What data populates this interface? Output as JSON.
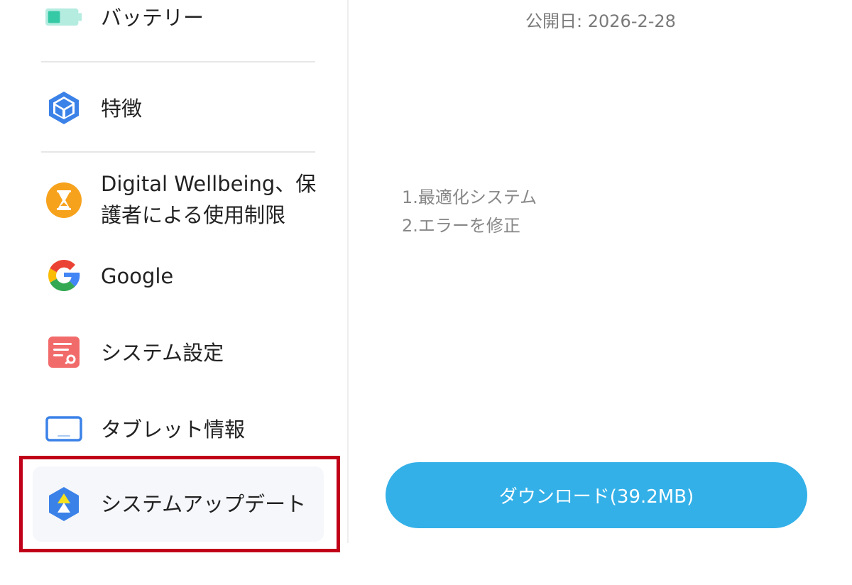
{
  "sidebar": {
    "items": [
      {
        "label": "バッテリー",
        "icon": "battery-icon"
      },
      {
        "label": "特徴",
        "icon": "cube-icon"
      },
      {
        "label_line1": "Digital Wellbeing、保",
        "label_line2": "護者による使用制限",
        "icon": "hourglass-icon"
      },
      {
        "label": "Google",
        "icon": "google-icon"
      },
      {
        "label": "システム設定",
        "icon": "settings-document-icon"
      },
      {
        "label": "タブレット情報",
        "icon": "tablet-icon"
      },
      {
        "label": "システムアップデート",
        "icon": "system-update-icon",
        "selected": true
      }
    ]
  },
  "main": {
    "publish_date": "公開日: 2026-2-28",
    "notes": [
      "1.最適化システム",
      "2.エラーを修正"
    ],
    "download_label": "ダウンロード(39.2MB)"
  },
  "colors": {
    "accent": "#33b0e8",
    "highlight": "#c00018",
    "battery": "#35c9a6",
    "cube": "#3b82e8",
    "hourglass": "#f7a21c",
    "settings": "#f26b6b",
    "tablet": "#3b82e8"
  }
}
